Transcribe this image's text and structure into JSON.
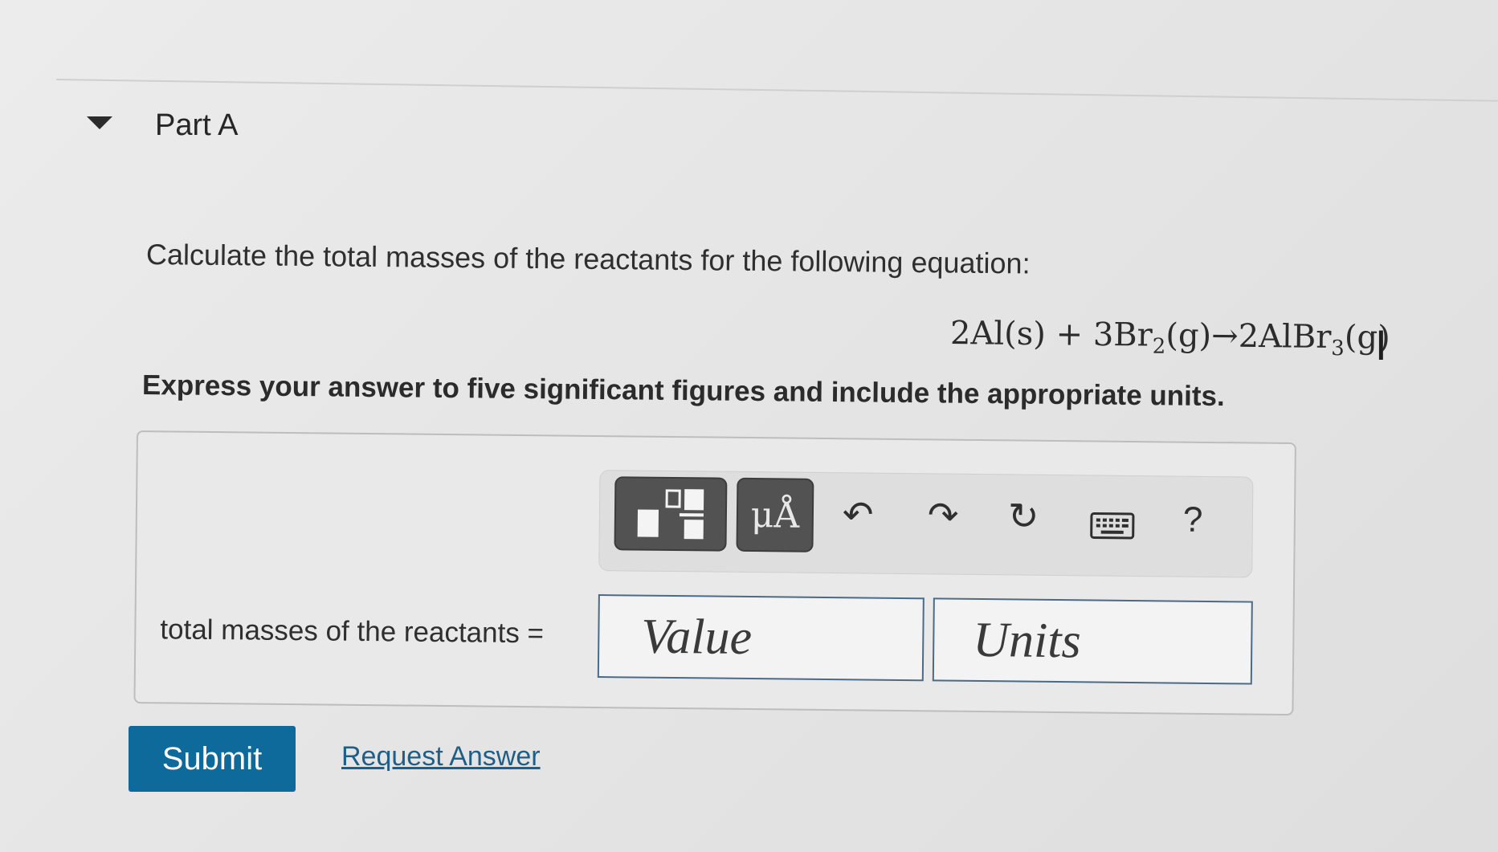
{
  "part": {
    "title": "Part A"
  },
  "question": {
    "prompt": "Calculate the total masses of the reactants for the following equation:",
    "equation": {
      "reactant1": "2Al(s)",
      "plus": " + ",
      "reactant2_base": "3Br",
      "reactant2_sub": "2",
      "reactant2_state": "(g)",
      "arrow": "→",
      "product_base": "2AlBr",
      "product_sub": "3",
      "product_state": "(g)"
    },
    "instruction": "Express your answer to five significant figures and include the appropriate units."
  },
  "toolbar": {
    "templates_icon": "fraction-template-icon",
    "units_label": "μÅ",
    "undo_icon": "↶",
    "redo_icon": "↷",
    "reset_icon": "↻",
    "keyboard_icon": "keyboard-icon",
    "help_label": "?"
  },
  "answer": {
    "label": "total masses of the reactants =",
    "value_placeholder": "Value",
    "units_placeholder": "Units"
  },
  "actions": {
    "submit_label": "Submit",
    "request_answer_label": "Request Answer"
  },
  "colors": {
    "submit_bg": "#0d6a9a",
    "link": "#1f5e86",
    "toolbar_button_bg": "#525252",
    "input_border": "#4a6a86"
  }
}
